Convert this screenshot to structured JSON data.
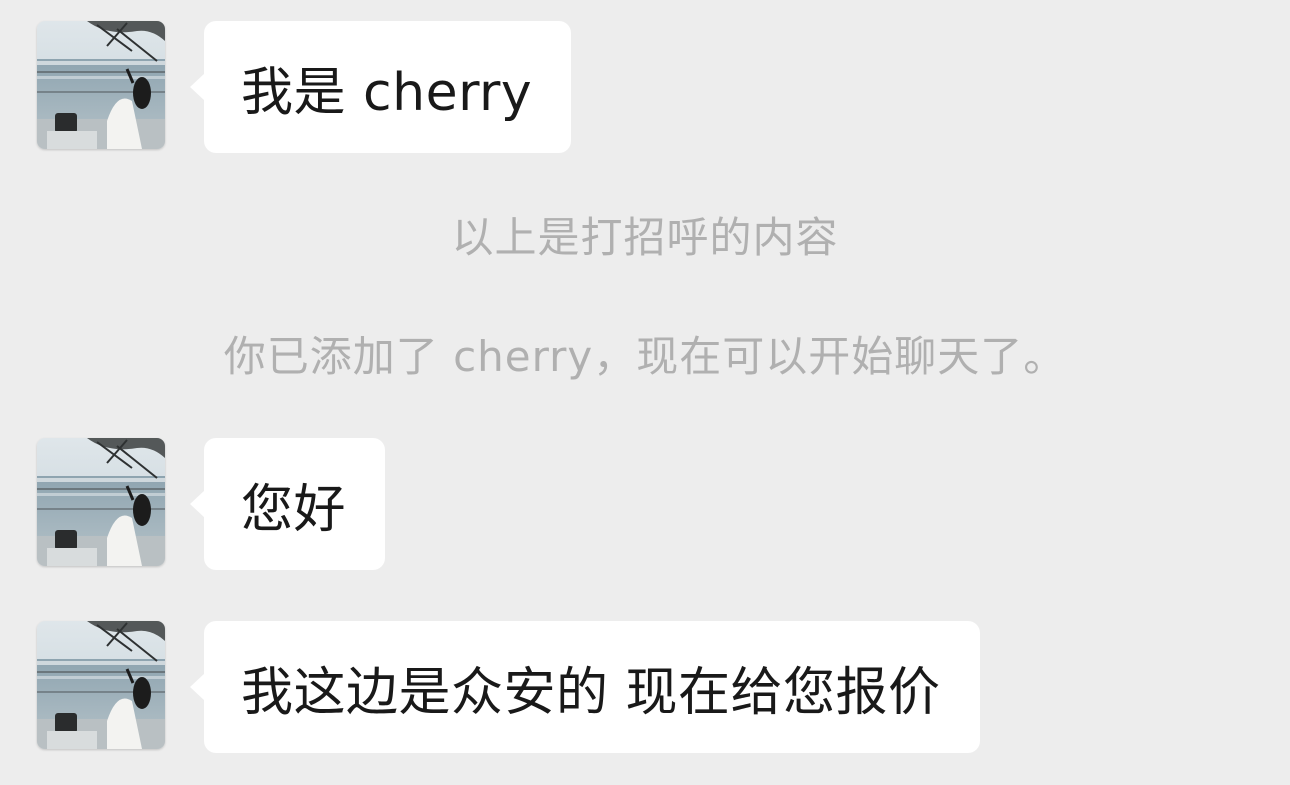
{
  "contact": {
    "name": "cherry"
  },
  "messages": [
    {
      "type": "incoming",
      "text": "我是 cherry"
    },
    {
      "type": "system",
      "text": "以上是打招呼的内容"
    },
    {
      "type": "system",
      "text": "你已添加了 cherry，现在可以开始聊天了。"
    },
    {
      "type": "incoming",
      "text": "您好"
    },
    {
      "type": "incoming",
      "text": "我这边是众安的 现在给您报价"
    }
  ],
  "colors": {
    "background": "#ededed",
    "bubble": "#ffffff",
    "message_text": "#191919",
    "system_text": "#b0b0b0"
  },
  "icons": {
    "avatar": "avatar-photo-woman-by-lake"
  }
}
